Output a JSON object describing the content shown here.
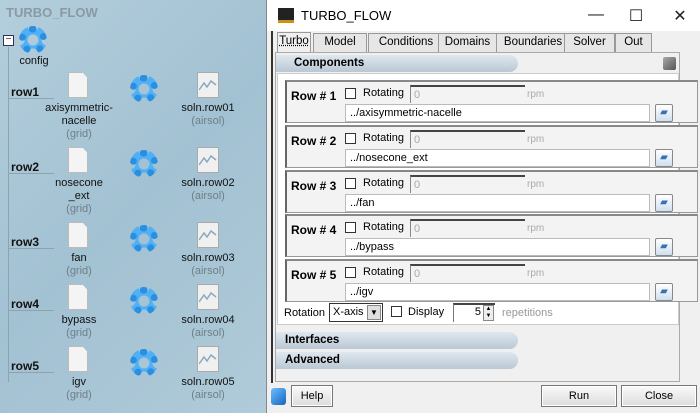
{
  "tree": {
    "title": "TURBO_FLOW",
    "config_label": "config",
    "rows": [
      {
        "label": "row1",
        "grid": "axisymmetric-\nnacelle",
        "grid_type": "(grid)",
        "soln": "soln.row01",
        "soln_type": "(airsol)"
      },
      {
        "label": "row2",
        "grid": "nosecone\n_ext",
        "grid_type": "(grid)",
        "soln": "soln.row02",
        "soln_type": "(airsol)"
      },
      {
        "label": "row3",
        "grid": "fan",
        "grid_type": "(grid)",
        "soln": "soln.row03",
        "soln_type": "(airsol)"
      },
      {
        "label": "row4",
        "grid": "bypass",
        "grid_type": "(grid)",
        "soln": "soln.row04",
        "soln_type": "(airsol)"
      },
      {
        "label": "row5",
        "grid": "igv",
        "grid_type": "(grid)",
        "soln": "soln.row05",
        "soln_type": "(airsol)"
      }
    ]
  },
  "window": {
    "title": "TURBO_FLOW",
    "minimize": "—",
    "maximize": "☐",
    "close": "✕"
  },
  "tabs": [
    "Turbo",
    "Model",
    "Conditions",
    "Domains",
    "Boundaries",
    "Solver",
    "Out"
  ],
  "components": {
    "header": "Components",
    "rows": [
      {
        "label": "Row # 1",
        "rotating_label": "Rotating",
        "rpm": "0",
        "unit": "rpm",
        "path": "../axisymmetric-nacelle"
      },
      {
        "label": "Row # 2",
        "rotating_label": "Rotating",
        "rpm": "0",
        "unit": "rpm",
        "path": "../nosecone_ext"
      },
      {
        "label": "Row # 3",
        "rotating_label": "Rotating",
        "rpm": "0",
        "unit": "rpm",
        "path": "../fan"
      },
      {
        "label": "Row # 4",
        "rotating_label": "Rotating",
        "rpm": "0",
        "unit": "rpm",
        "path": "../bypass"
      },
      {
        "label": "Row # 5",
        "rotating_label": "Rotating",
        "rpm": "0",
        "unit": "rpm",
        "path": "../igv"
      }
    ],
    "rotation_label": "Rotation",
    "rotation_value": "X-axis",
    "display_label": "Display",
    "repetitions": "5",
    "repetitions_label": "repetitions"
  },
  "sections": {
    "interfaces": "Interfaces",
    "advanced": "Advanced"
  },
  "buttons": {
    "help": "Help",
    "run": "Run",
    "close": "Close"
  }
}
